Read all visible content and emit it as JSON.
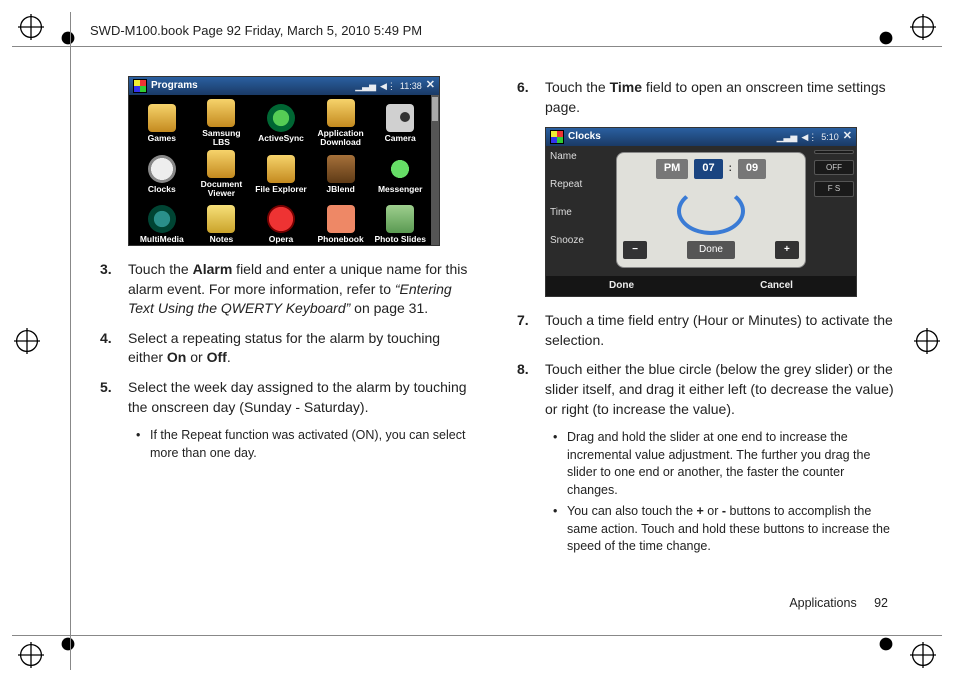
{
  "header": "SWD-M100.book  Page 92  Friday, March 5, 2010  5:49 PM",
  "footer": {
    "section": "Applications",
    "page": "92"
  },
  "fig1": {
    "title": "Programs",
    "time": "11:38",
    "apps": [
      "Games",
      "Samsung LBS",
      "ActiveSync",
      "Application Download",
      "Camera",
      "Clocks",
      "Document Viewer",
      "File Explorer",
      "JBlend",
      "Messenger",
      "MultiMedia",
      "Notes",
      "Opera",
      "Phonebook",
      "Photo Slides"
    ]
  },
  "fig2": {
    "title": "Clocks",
    "time": "5:10",
    "left_labels": [
      "Name",
      "Repeat",
      "Time",
      "Snooze"
    ],
    "right_labels": [
      "",
      "OFF",
      "F   S"
    ],
    "dial": {
      "ampm": "PM",
      "hour": "07",
      "min": "09",
      "done": "Done"
    },
    "footer": {
      "left": "Done",
      "right": "Cancel"
    }
  },
  "left_col": {
    "s3a": "Touch the ",
    "s3_b1": "Alarm",
    "s3b": " field and enter a unique name for this alarm event. For more information, refer to ",
    "s3_i": "“Entering Text Using the QWERTY Keyboard”",
    "s3c": "  on page 31.",
    "s4a": "Select a repeating status for the alarm by touching either ",
    "s4_b1": "On",
    "s4b": " or ",
    "s4_b2": "Off",
    "s4c": ".",
    "s5": "Select the week day assigned to the alarm by touching the onscreen day (Sunday - Saturday).",
    "s5_bullet": "If the Repeat function was activated (ON), you can select more than one day."
  },
  "right_col": {
    "s6a": "Touch the ",
    "s6_b1": "Time",
    "s6b": " field to open an onscreen time settings page.",
    "s7": "Touch a time field entry (Hour or Minutes) to activate the selection.",
    "s8": "Touch either the blue circle (below the grey slider) or the slider itself, and drag it either left (to decrease the value) or right (to increase the value).",
    "s8_bullet1": "Drag and hold the slider at one end to increase the incremental value adjustment. The further you drag the slider to one end or another, the faster the counter changes.",
    "s8_bullet2a": "You can also touch the ",
    "s8_b1": "+",
    "s8_bullet2b": " or ",
    "s8_b2": "-",
    "s8_bullet2c": " buttons to accomplish the same action. Touch and hold these buttons to increase the speed of the time change."
  },
  "nums": {
    "n3": "3.",
    "n4": "4.",
    "n5": "5.",
    "n6": "6.",
    "n7": "7.",
    "n8": "8."
  }
}
